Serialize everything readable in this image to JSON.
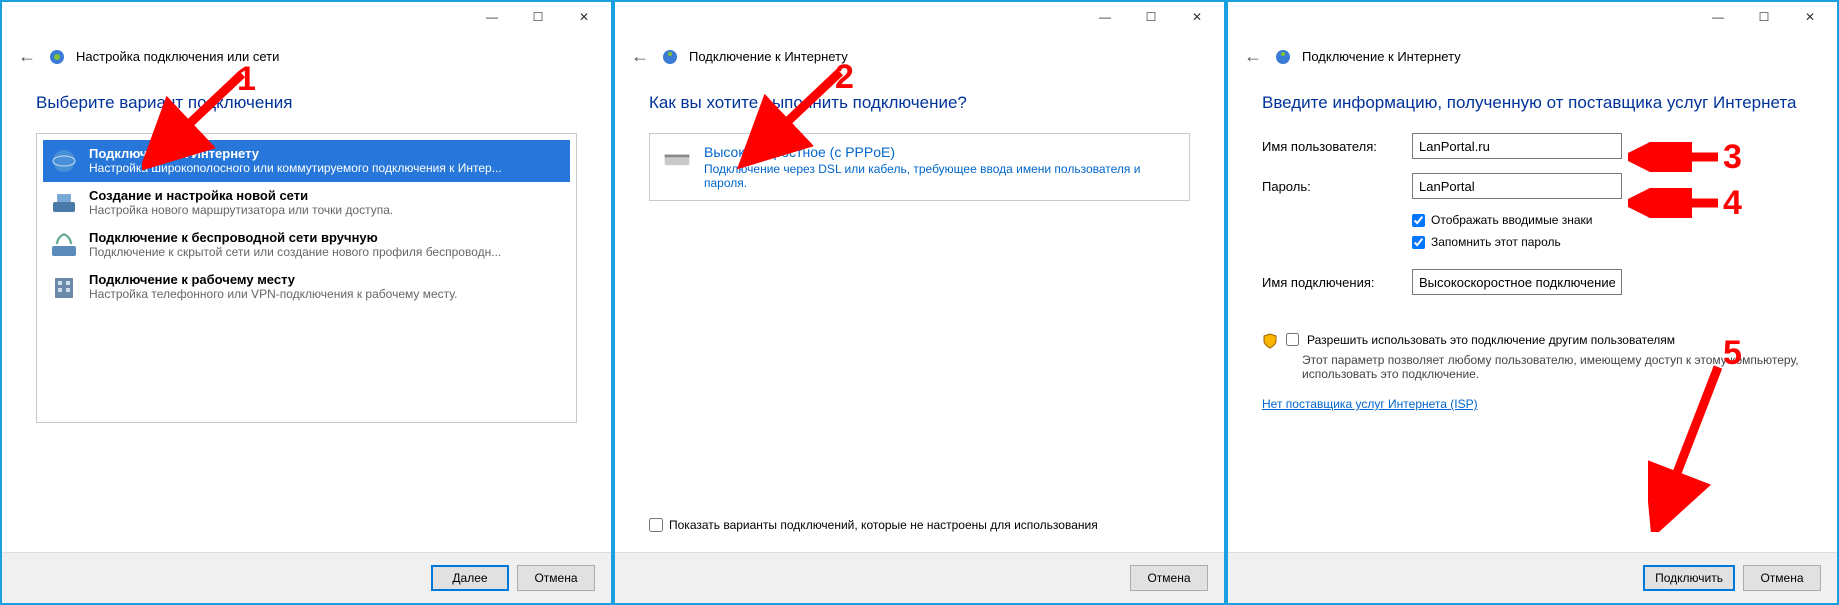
{
  "annotations": {
    "a1": "1",
    "a2": "2",
    "a3": "3",
    "a4": "4",
    "a5": "5"
  },
  "window1": {
    "header": "Настройка подключения или сети",
    "heading": "Выберите вариант подключения",
    "options": [
      {
        "title": "Подключение к Интернету",
        "desc": "Настройка широкополосного или коммутируемого подключения к Интер..."
      },
      {
        "title": "Создание и настройка новой сети",
        "desc": "Настройка нового маршрутизатора или точки доступа."
      },
      {
        "title": "Подключение к беспроводной сети вручную",
        "desc": "Подключение к скрытой сети или создание нового профиля беспроводн..."
      },
      {
        "title": "Подключение к рабочему месту",
        "desc": "Настройка телефонного или VPN-подключения к рабочему месту."
      }
    ],
    "next": "Далее",
    "cancel": "Отмена"
  },
  "window2": {
    "header": "Подключение к Интернету",
    "heading": "Как вы хотите выполнить подключение?",
    "option_title": "Высокоскоростное (с PPPoE)",
    "option_desc": "Подключение через DSL или кабель, требующее ввода имени пользователя и пароля.",
    "show_unconfigured": "Показать варианты подключений, которые не настроены для использования",
    "cancel": "Отмена"
  },
  "window3": {
    "header": "Подключение к Интернету",
    "heading": "Введите информацию, полученную от поставщика услуг Интернета",
    "username_label": "Имя пользователя:",
    "username_value": "LanPortal.ru",
    "password_label": "Пароль:",
    "password_value": "LanPortal",
    "show_chars": "Отображать вводимые знаки",
    "remember": "Запомнить этот пароль",
    "connname_label": "Имя подключения:",
    "connname_value": "Высокоскоростное подключение",
    "allow_others": "Разрешить использовать это подключение другим пользователям",
    "allow_desc": "Этот параметр позволяет любому пользователю, имеющему доступ к этому компьютеру, использовать это подключение.",
    "no_isp": "Нет поставщика услуг Интернета (ISP)",
    "connect": "Подключить",
    "cancel": "Отмена"
  }
}
